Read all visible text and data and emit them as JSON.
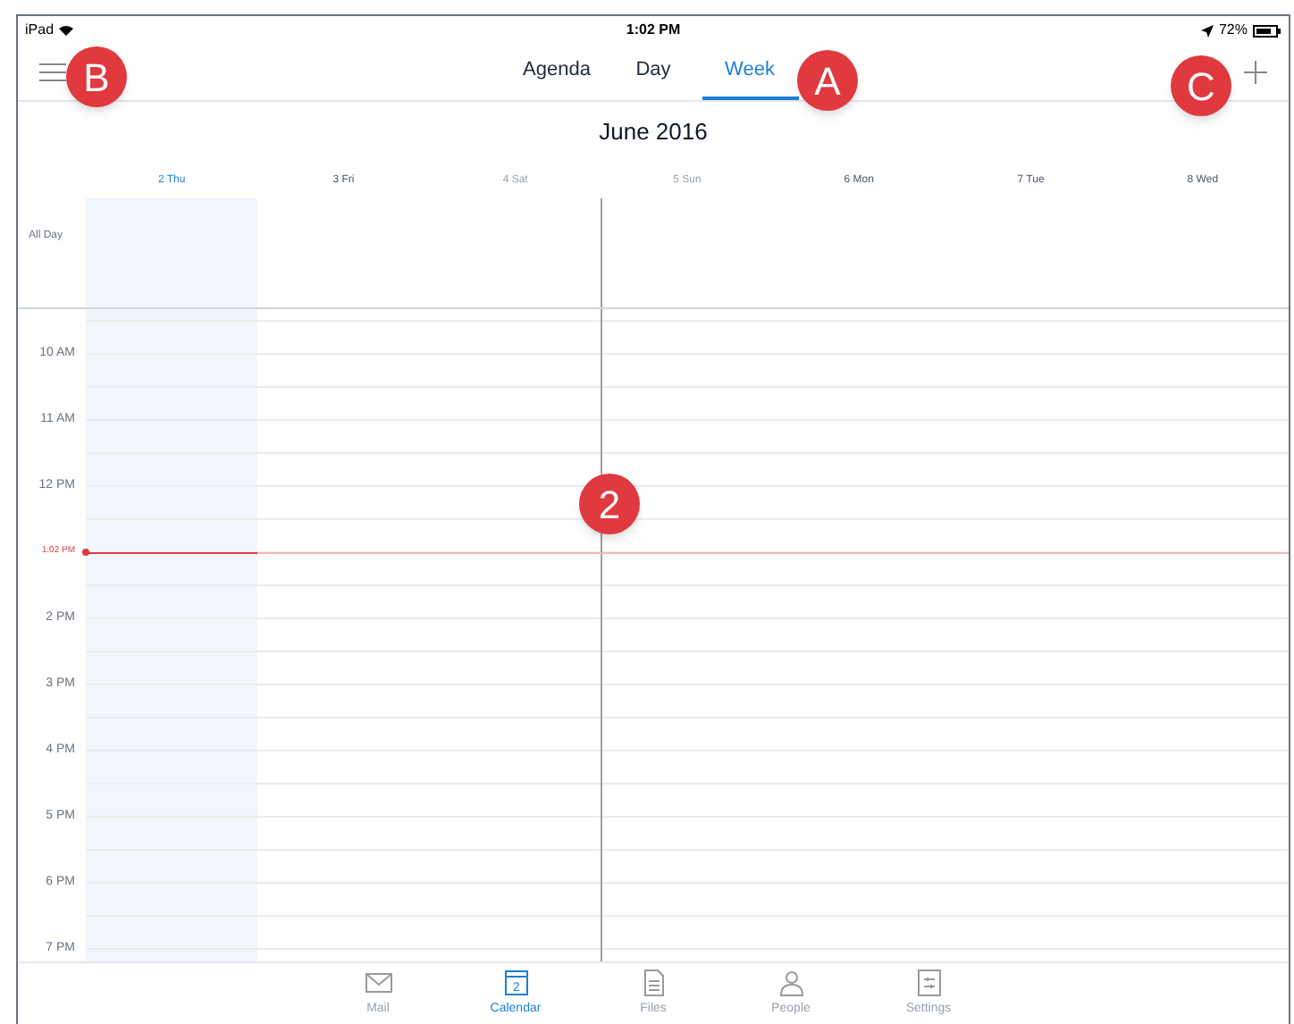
{
  "status_bar": {
    "device": "iPad",
    "time": "1:02 PM",
    "battery": "72%"
  },
  "nav_tabs": [
    {
      "label": "Agenda",
      "selected": false
    },
    {
      "label": "Day",
      "selected": false
    },
    {
      "label": "Week",
      "selected": true
    }
  ],
  "month_title": "June 2016",
  "days": [
    {
      "label": "2 Thu",
      "kind": "today",
      "divider_before": false
    },
    {
      "label": "3 Fri",
      "kind": "weekday",
      "divider_before": false
    },
    {
      "label": "4 Sat",
      "kind": "weekend",
      "divider_before": false
    },
    {
      "label": "5 Sun",
      "kind": "weekend",
      "divider_before": true
    },
    {
      "label": "6 Mon",
      "kind": "weekday",
      "divider_before": false
    },
    {
      "label": "7 Tue",
      "kind": "weekday",
      "divider_before": false
    },
    {
      "label": "8 Wed",
      "kind": "weekday",
      "divider_before": false
    }
  ],
  "all_day_label": "All Day",
  "hours": [
    {
      "label": "10 AM",
      "kind": "hour"
    },
    {
      "label": "11 AM",
      "kind": "hour"
    },
    {
      "label": "12 PM",
      "kind": "hour"
    },
    {
      "label": "1:02 PM",
      "kind": "now"
    },
    {
      "label": "2 PM",
      "kind": "hour"
    },
    {
      "label": "3 PM",
      "kind": "hour"
    },
    {
      "label": "4 PM",
      "kind": "hour"
    },
    {
      "label": "5 PM",
      "kind": "hour"
    },
    {
      "label": "6 PM",
      "kind": "hour"
    },
    {
      "label": "7 PM",
      "kind": "hour"
    }
  ],
  "tab_bar": [
    {
      "label": "Mail",
      "kind": "mail",
      "selected": false
    },
    {
      "label": "Calendar",
      "kind": "calendar",
      "selected": true,
      "icon_text": "2"
    },
    {
      "label": "Files",
      "kind": "files",
      "selected": false
    },
    {
      "label": "People",
      "kind": "people",
      "selected": false
    },
    {
      "label": "Settings",
      "kind": "settings",
      "selected": false
    }
  ],
  "callouts": [
    {
      "label": "B"
    },
    {
      "label": "A"
    },
    {
      "label": "C"
    },
    {
      "label": "2"
    }
  ]
}
